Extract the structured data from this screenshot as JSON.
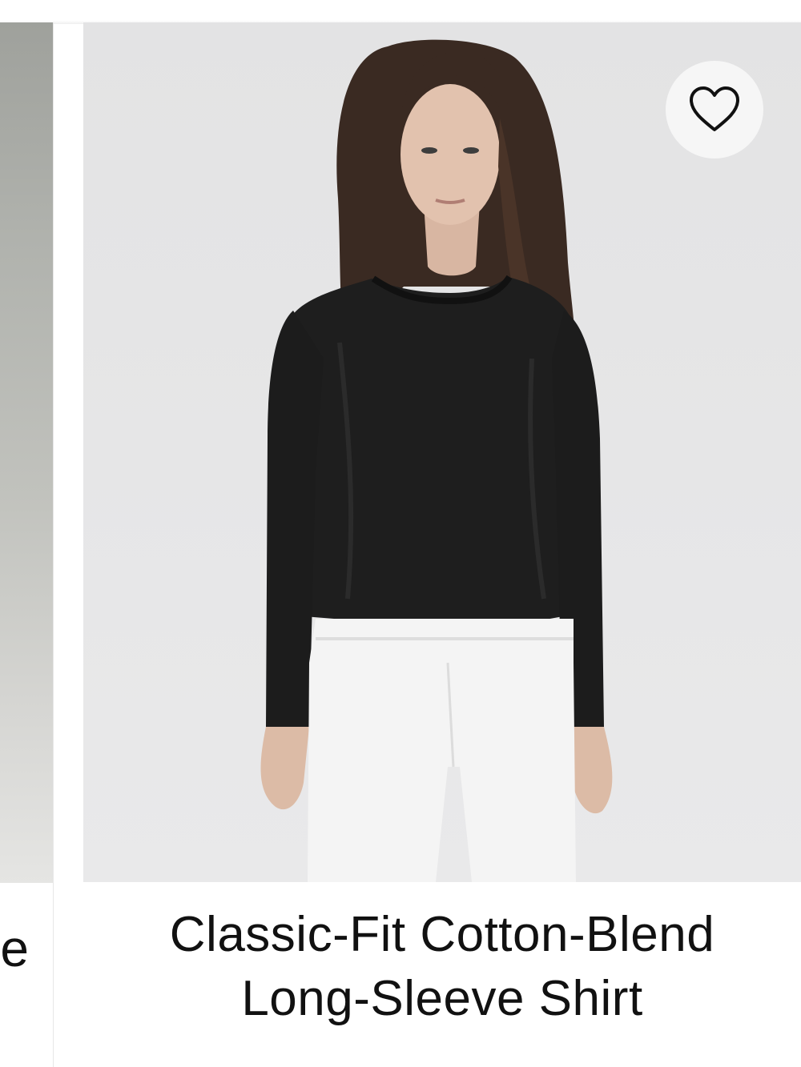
{
  "grid": {
    "left_card": {
      "title_fragment": "e"
    },
    "main_card": {
      "title_line_1": "Classic-Fit Cotton-Blend",
      "title_line_2": "Long-Sleeve Shirt",
      "wishlist_icon": "heart-outline-icon"
    }
  },
  "colors": {
    "text": "#111111",
    "image_bg": "#e6e6e7",
    "wishlist_bg": "#f6f6f6",
    "shirt": "#1e1e1e",
    "shorts": "#f4f4f4"
  }
}
